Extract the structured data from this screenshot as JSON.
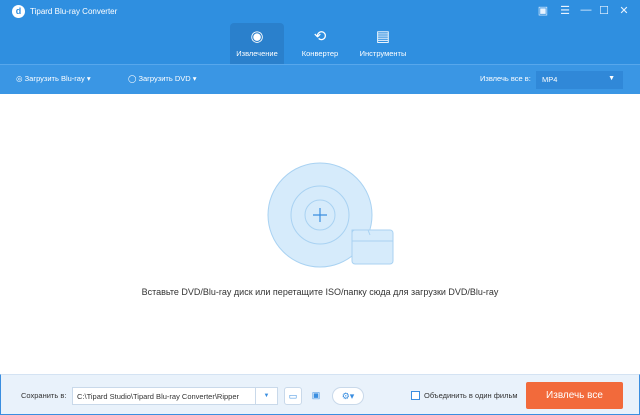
{
  "app": {
    "title": "Tipard Blu-ray Converter"
  },
  "tabs": [
    {
      "label": "Извлечение",
      "icon": "disc-icon",
      "active": true
    },
    {
      "label": "Конвертер",
      "icon": "convert-icon"
    },
    {
      "label": "Инструменты",
      "icon": "toolbox-icon"
    }
  ],
  "toolbar": {
    "load_bluray": "Загрузить Blu-ray",
    "load_dvd": "Загрузить DVD",
    "extract_all_to_label": "Извлечь все в:",
    "format": "MP4"
  },
  "main": {
    "message": "Вставьте DVD/Blu-ray диск или перетащите ISO/папку сюда для загрузки DVD/Blu-ray"
  },
  "footer": {
    "save_label": "Сохранить в:",
    "save_path": "C:\\Tipard Studio\\Tipard Blu-ray Converter\\Ripper",
    "merge_label": "Объединить в один фильм",
    "merge_checked": false,
    "extract_all_button": "Извлечь все"
  },
  "colors": {
    "accent": "#2f8fe0",
    "button": "#f26a3b"
  }
}
